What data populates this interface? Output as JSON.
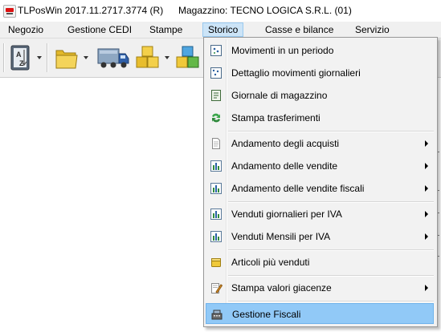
{
  "window": {
    "title": "TLPosWin 2017.11.2717.3774 (R)",
    "store": "Magazzino: TECNO LOGICA S.R.L. (01)"
  },
  "menubar": {
    "items": [
      {
        "label": "Negozio"
      },
      {
        "label": "Gestione CEDI"
      },
      {
        "label": "Stampe"
      },
      {
        "label": "Storico"
      },
      {
        "label": "Casse e bilance"
      },
      {
        "label": "Servizio"
      }
    ],
    "active_index": 3
  },
  "toolbar": {
    "icons": [
      "az-sort-icon",
      "folder-icon",
      "truck-icon",
      "boxes-icon",
      "multicolor-boxes-icon"
    ]
  },
  "storico_menu": {
    "items": [
      {
        "label": "Movimenti in un periodo",
        "icon": "calendar-dots-icon",
        "submenu": false
      },
      {
        "label": "Dettaglio movimenti giornalieri",
        "icon": "calendar-detail-icon",
        "submenu": false
      },
      {
        "label": "Giornale di magazzino",
        "icon": "journal-icon",
        "submenu": false
      },
      {
        "label": "Stampa trasferimenti",
        "icon": "transfer-arrows-icon",
        "submenu": false
      },
      {
        "label": "Andamento degli acquisti",
        "icon": "document-icon",
        "submenu": true
      },
      {
        "label": "Andamento delle vendite",
        "icon": "bar-chart-icon",
        "submenu": true
      },
      {
        "label": "Andamento delle vendite fiscali",
        "icon": "bar-chart-icon",
        "submenu": true
      },
      {
        "label": "Venduti giornalieri per IVA",
        "icon": "bar-chart-icon",
        "submenu": true
      },
      {
        "label": "Venduti Mensili per IVA",
        "icon": "bar-chart-icon",
        "submenu": true
      },
      {
        "label": "Articoli più venduti",
        "icon": "gold-box-icon",
        "submenu": false
      },
      {
        "label": "Stampa valori giacenze",
        "icon": "pencil-paper-icon",
        "submenu": true
      },
      {
        "label": "Gestione Fiscali",
        "icon": "cash-register-icon",
        "submenu": false
      }
    ],
    "highlighted_index": 11
  }
}
